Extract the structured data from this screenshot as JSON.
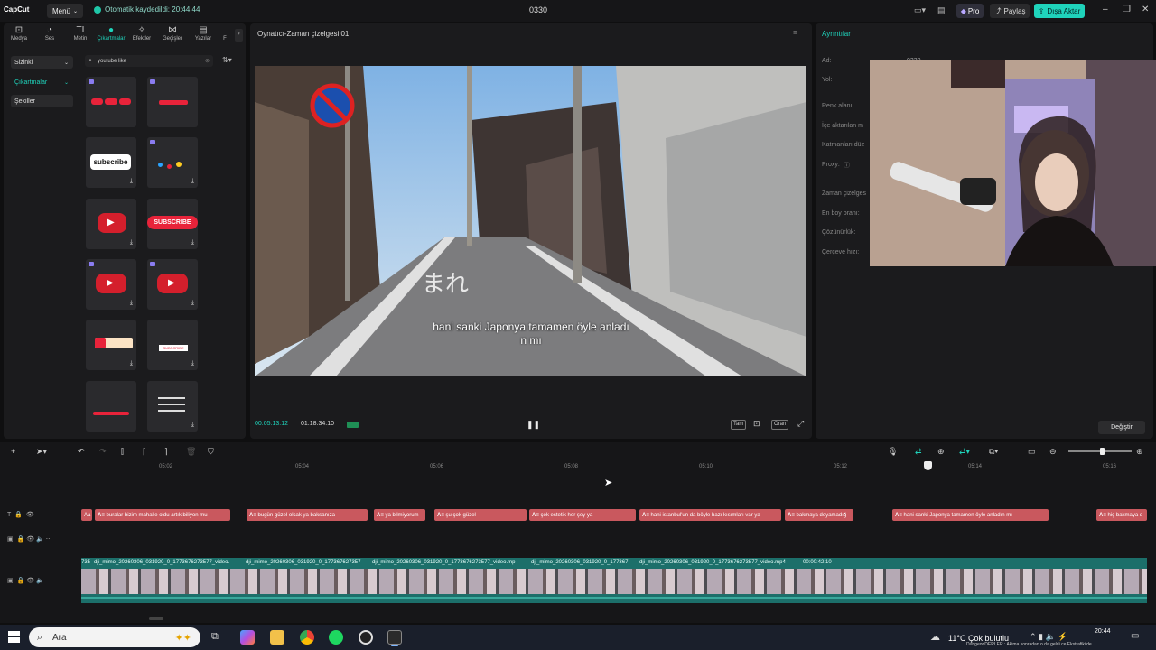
{
  "titlebar": {
    "logo": "CapCut",
    "menu_label": "Menü",
    "autosave": "Otomatik kaydedildi: 20:44:44",
    "project_name": "0330",
    "pro_label": "Pro",
    "share_label": "Paylaş",
    "export_label": "Dışa Aktar"
  },
  "tool_tabs": [
    {
      "label": "Medya",
      "icon": "media-icon"
    },
    {
      "label": "Ses",
      "icon": "audio-icon"
    },
    {
      "label": "Metin",
      "icon": "text-icon"
    },
    {
      "label": "Çıkartmalar",
      "icon": "sticker-icon"
    },
    {
      "label": "Efektler",
      "icon": "effects-icon"
    },
    {
      "label": "Geçişler",
      "icon": "transitions-icon"
    },
    {
      "label": "Yazılar",
      "icon": "captions-icon"
    },
    {
      "label": "F",
      "icon": "filters-icon"
    }
  ],
  "sidebar": {
    "yours": "Sizinki",
    "stickers": "Çıkartmalar",
    "shapes": "Şekiller"
  },
  "search": {
    "value": "youtube like"
  },
  "stickers": [
    {
      "kind": "like-sub-bell"
    },
    {
      "kind": "red-bar"
    },
    {
      "kind": "subscribe-text",
      "text": "subscribe"
    },
    {
      "kind": "colorful"
    },
    {
      "kind": "yt-play"
    },
    {
      "kind": "subscribe-button",
      "text": "SUBSCRIBE"
    },
    {
      "kind": "yt-play"
    },
    {
      "kind": "yt-play"
    },
    {
      "kind": "yt-bar"
    },
    {
      "kind": "subscribe-small",
      "text": "SUBSCRIBE"
    },
    {
      "kind": "red-bar"
    },
    {
      "kind": "menu-list"
    }
  ],
  "player": {
    "title": "Oynatıcı-Zaman çizelgesi 01",
    "subtitle_line1": "hani sanki Japonya tamamen öyle anladı",
    "subtitle_line2": "n mı",
    "time_current": "00:05:13:12",
    "time_total": "01:18:34:10",
    "btn_full": "Tam",
    "btn_ratio": "Oran"
  },
  "details": {
    "title": "Ayrıntılar",
    "labels": [
      "Ad:",
      "Yol:",
      "Renk alanı:",
      "İçe aktarılan m",
      "Katmanları düz",
      "Proxy:",
      "Zaman çizelges",
      "En boy oranı:",
      "Çözünürlük:",
      "Çerçeve hızı:"
    ],
    "name_value": "0330",
    "change_label": "Değiştir"
  },
  "timeline": {
    "ruler": [
      "05:02",
      "05:04",
      "05:06",
      "05:08",
      "05:10",
      "05:12",
      "05:14",
      "05:16"
    ],
    "captions": [
      {
        "text": "buralar bizim mahalle oldu artık biliyon mu"
      },
      {
        "text": "bugün güzel olcak ya baksanıza"
      },
      {
        "text": "ya bilmiyorum"
      },
      {
        "text": "şu çok güzel"
      },
      {
        "text": "çok estetik her şey ya"
      },
      {
        "text": "hani istanbul'un da böyle bazı kısımları var ya"
      },
      {
        "text": "bakmaya doyamadığ"
      },
      {
        "text": "hani sanki Japonya tamamen öyle anladın mı"
      },
      {
        "text": "hiç bakmaya d"
      }
    ],
    "video_labels": [
      "735",
      "dji_mimo_20260306_031920_0_1773676273577_video.",
      "dji_mimo_20260306_031920_0_177367627357",
      "dji_mimo_20260306_031920_0_1773676273577_video.mp",
      "dji_mimo_20260306_031920_0_177367",
      "dji_mimo_20260306_031920_0_1773676273577_video.mp4",
      "00:00:42:10"
    ]
  },
  "taskbar": {
    "search_placeholder": "Ara",
    "weather": "11°C  Çok bulutlu",
    "time": "20:44",
    "ticker": "DungeonDERLER : Akima sonradan o da geldi ce Ekstrafikilde"
  },
  "colors": {
    "accent": "#1fd3bb",
    "caption_clip": "#c9585e",
    "video_track": "#1c6f6a"
  }
}
